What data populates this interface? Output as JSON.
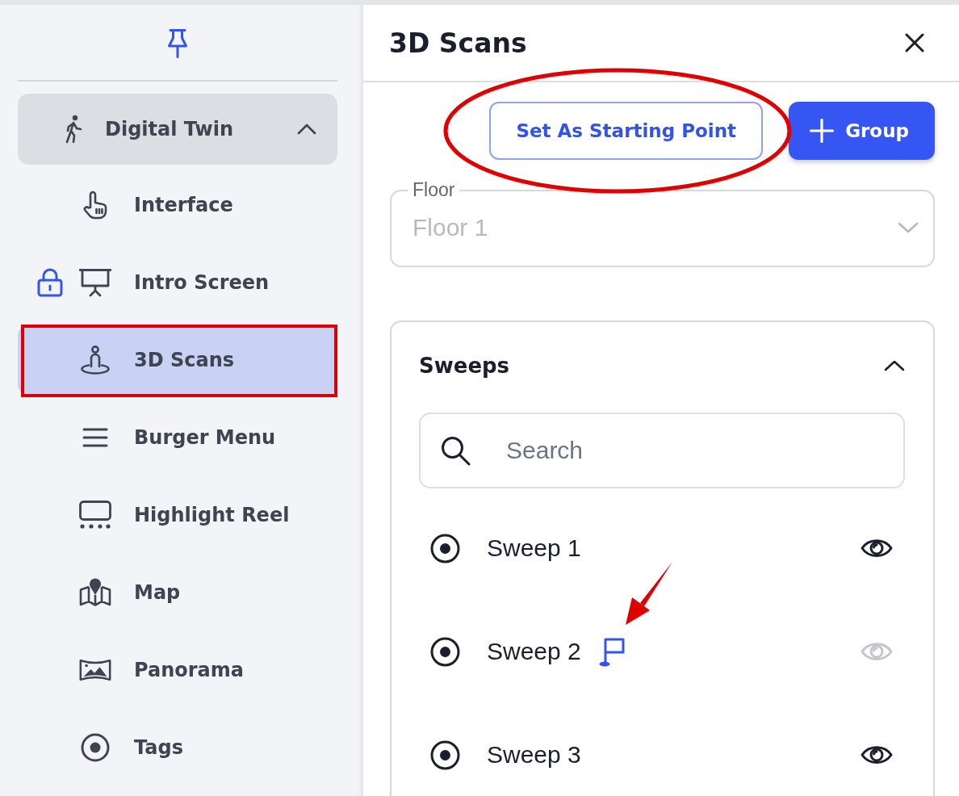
{
  "sidebar": {
    "group": {
      "label": "Digital Twin",
      "expanded": true
    },
    "items": [
      {
        "label": "Interface",
        "locked": false,
        "selected": false
      },
      {
        "label": "Intro Screen",
        "locked": true,
        "selected": false
      },
      {
        "label": "3D Scans",
        "locked": false,
        "selected": true
      },
      {
        "label": "Burger Menu",
        "locked": false,
        "selected": false
      },
      {
        "label": "Highlight Reel",
        "locked": false,
        "selected": false
      },
      {
        "label": "Map",
        "locked": false,
        "selected": false
      },
      {
        "label": "Panorama",
        "locked": false,
        "selected": false
      },
      {
        "label": "Tags",
        "locked": false,
        "selected": false
      }
    ]
  },
  "panel": {
    "title": "3D Scans",
    "buttons": [
      {
        "label": "Set As Starting Point",
        "kind": "outline"
      },
      {
        "label": "Group",
        "kind": "primary"
      }
    ],
    "floor_select": {
      "label": "Floor",
      "value": "Floor 1",
      "disabled": true
    },
    "sweeps": {
      "title": "Sweeps",
      "expanded": true,
      "search": {
        "placeholder": "Search"
      },
      "items": [
        {
          "name": "Sweep 1",
          "visible": true,
          "starting_point": false
        },
        {
          "name": "Sweep 2",
          "visible": false,
          "starting_point": true
        },
        {
          "name": "Sweep 3",
          "visible": true,
          "starting_point": false
        }
      ]
    }
  }
}
